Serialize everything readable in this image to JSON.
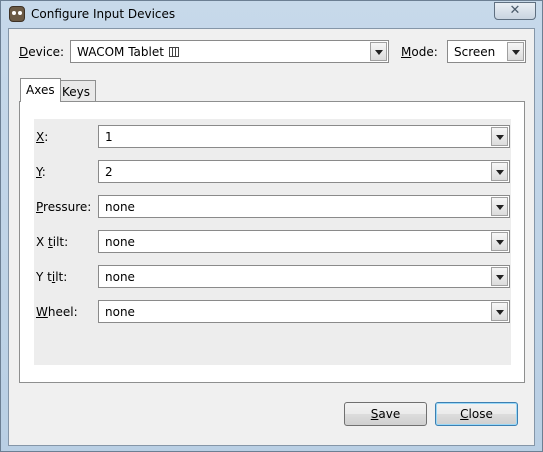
{
  "window": {
    "title": "Configure Input Devices",
    "close_glyph": "✕"
  },
  "device": {
    "label_prefix": "",
    "label_accel": "D",
    "label_rest": "evice:",
    "value": "WACOM Tablet"
  },
  "mode": {
    "label_accel": "M",
    "label_rest": "ode:",
    "value": "Screen"
  },
  "tabs": [
    {
      "label": "Axes",
      "active": true
    },
    {
      "label": "Keys",
      "active": false
    }
  ],
  "axes": [
    {
      "pre": "",
      "accel": "X",
      "post": ":",
      "value": "1"
    },
    {
      "pre": "",
      "accel": "Y",
      "post": ":",
      "value": "2"
    },
    {
      "pre": "",
      "accel": "P",
      "post": "ressure:",
      "value": "none"
    },
    {
      "pre": "X ",
      "accel": "t",
      "post": "ilt:",
      "value": "none"
    },
    {
      "pre": "Y t",
      "accel": "i",
      "post": "lt:",
      "value": "none"
    },
    {
      "pre": "",
      "accel": "W",
      "post": "heel:",
      "value": "none"
    }
  ],
  "buttons": {
    "save_accel": "S",
    "save_rest": "ave",
    "close_accel": "C",
    "close_rest": "lose"
  },
  "icons": {
    "app": "gimp-icon",
    "window_close": "close-icon",
    "dropdown": "chevron-down-icon",
    "tablet": "tablet-icon"
  }
}
